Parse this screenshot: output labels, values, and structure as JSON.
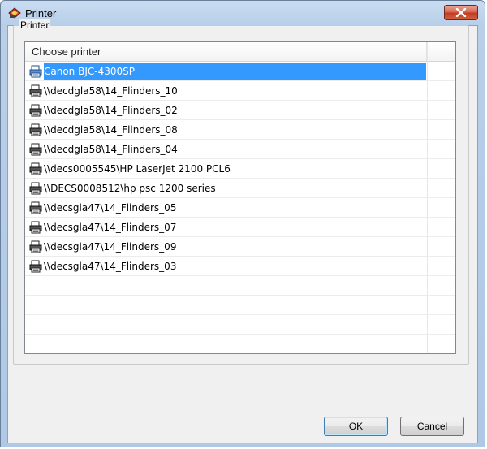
{
  "window": {
    "title": "Printer",
    "close_icon": "close-x-icon"
  },
  "group": {
    "label": "Printer"
  },
  "list": {
    "column_header": "Choose printer",
    "selected_index": 0,
    "printer_icon": "printer-icon",
    "items": [
      "Canon BJC-4300SP",
      "\\\\decdgla58\\14_Flinders_10",
      "\\\\decdgla58\\14_Flinders_02",
      "\\\\decdgla58\\14_Flinders_08",
      "\\\\decdgla58\\14_Flinders_04",
      "\\\\decs0005545\\HP LaserJet 2100 PCL6",
      "\\\\DECS0008512\\hp psc 1200 series",
      "\\\\decsgla47\\14_Flinders_05",
      "\\\\decsgla47\\14_Flinders_07",
      "\\\\decsgla47\\14_Flinders_09",
      "\\\\decsgla47\\14_Flinders_03"
    ]
  },
  "buttons": {
    "ok": "OK",
    "cancel": "Cancel"
  },
  "colors": {
    "selection": "#3399ff",
    "titlebar": "#b8cfe9"
  }
}
